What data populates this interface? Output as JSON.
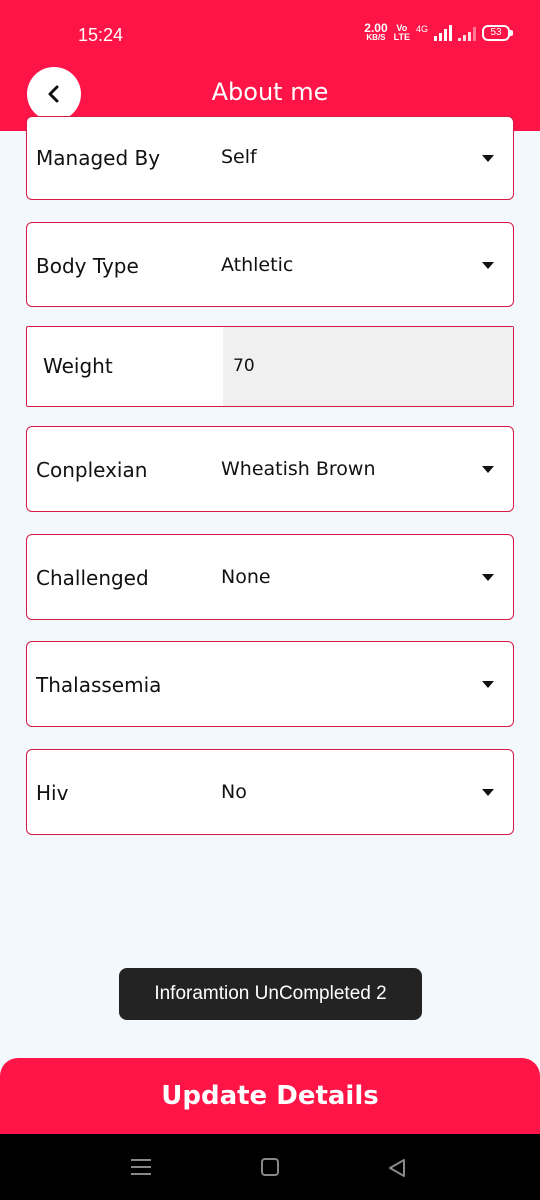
{
  "status_bar": {
    "time": "15:24",
    "net_speed_value": "2.00",
    "net_speed_unit": "KB/S",
    "volte_top": "Vo",
    "volte_bottom": "LTE",
    "network": "4G",
    "battery": "53"
  },
  "header": {
    "title": "About me",
    "back_icon": "chevron-left-icon"
  },
  "fields": [
    {
      "label": "Managed By",
      "value": "Self"
    },
    {
      "label": "Body Type",
      "value": "Athletic"
    },
    {
      "label": "Weight",
      "value": "70"
    },
    {
      "label": "Conplexian",
      "value": "Wheatish Brown"
    },
    {
      "label": "Challenged",
      "value": "None"
    },
    {
      "label": "Thalassemia",
      "value": ""
    },
    {
      "label": "Hiv",
      "value": "No"
    }
  ],
  "toast": {
    "text": "Inforamtion UnCompleted 2"
  },
  "actions": {
    "update_label": "Update Details"
  },
  "colors": {
    "accent": "#ff1447",
    "field_border": "#d61a45",
    "background": "#f3f8fc",
    "toast_bg": "#232323"
  }
}
